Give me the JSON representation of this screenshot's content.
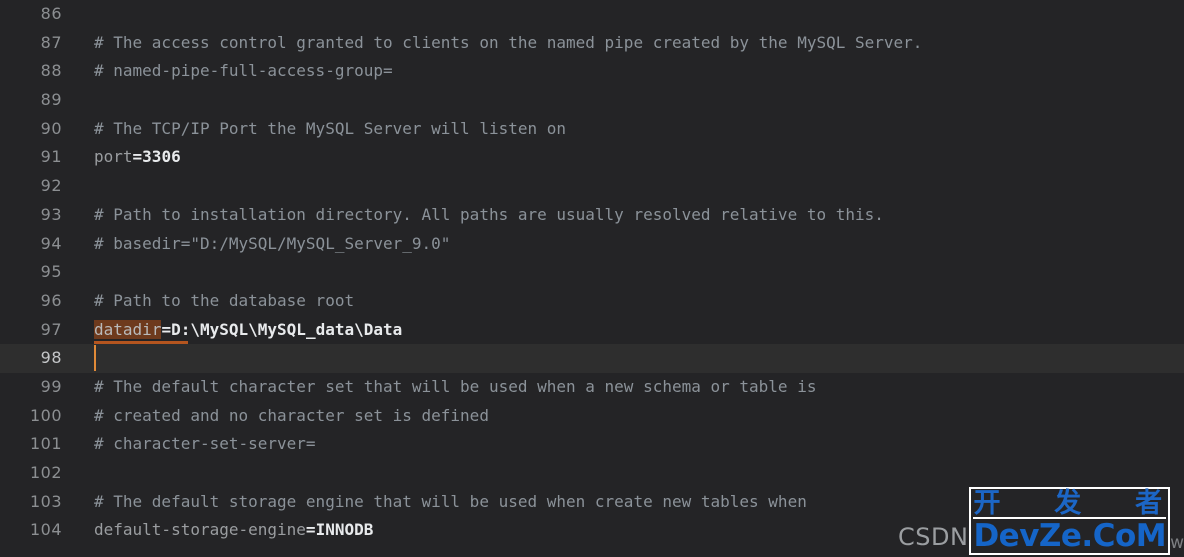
{
  "editor": {
    "theme": "dark",
    "file_type": "ini",
    "background_color": "#242426",
    "current_line_color": "#2e2e2e",
    "caret_color": "#e08a38",
    "search_highlight_color": "#6e3a1d",
    "gutter_color": "#8c8f92",
    "comment_color": "#8b9299",
    "key_color": "#9a9da0",
    "value_color": "#e8eaec",
    "first_visible_line": 86,
    "last_visible_line": 104,
    "caret_line": 98,
    "highlighted_token": "datadir",
    "lines": [
      {
        "number": "86",
        "current": false,
        "tokens": []
      },
      {
        "number": "87",
        "current": false,
        "tokens": [
          {
            "kind": "cmt",
            "text": "# The access control granted to clients on the named pipe created by the MySQL Server."
          }
        ]
      },
      {
        "number": "88",
        "current": false,
        "tokens": [
          {
            "kind": "cmt",
            "text": "# named-pipe-full-access-group="
          }
        ]
      },
      {
        "number": "89",
        "current": false,
        "tokens": []
      },
      {
        "number": "90",
        "current": false,
        "tokens": [
          {
            "kind": "cmt",
            "text": "# The TCP/IP Port the MySQL Server will listen on"
          }
        ]
      },
      {
        "number": "91",
        "current": false,
        "tokens": [
          {
            "kind": "key",
            "text": "port"
          },
          {
            "kind": "eq",
            "text": "="
          },
          {
            "kind": "val",
            "text": "3306"
          }
        ]
      },
      {
        "number": "92",
        "current": false,
        "tokens": []
      },
      {
        "number": "93",
        "current": false,
        "tokens": [
          {
            "kind": "cmt",
            "text": "# Path to installation directory. All paths are usually resolved relative to this."
          }
        ]
      },
      {
        "number": "94",
        "current": false,
        "tokens": [
          {
            "kind": "cmt",
            "text": "# basedir=\"D:/MySQL/MySQL_Server_9.0\""
          }
        ]
      },
      {
        "number": "95",
        "current": false,
        "tokens": []
      },
      {
        "number": "96",
        "current": false,
        "tokens": [
          {
            "kind": "cmt",
            "text": "# Path to the database root"
          }
        ]
      },
      {
        "number": "97",
        "current": false,
        "tokens": [
          {
            "kind": "hl",
            "text": "datadir"
          },
          {
            "kind": "eq",
            "text": "="
          },
          {
            "kind": "val",
            "text": "D:\\MySQL\\MySQL_data\\Data"
          }
        ]
      },
      {
        "number": "98",
        "current": true,
        "tokens": []
      },
      {
        "number": "99",
        "current": false,
        "tokens": [
          {
            "kind": "cmt",
            "text": "# The default character set that will be used when a new schema or table is"
          }
        ]
      },
      {
        "number": "100",
        "current": false,
        "tokens": [
          {
            "kind": "cmt",
            "text": "# created and no character set is defined"
          }
        ]
      },
      {
        "number": "101",
        "current": false,
        "tokens": [
          {
            "kind": "cmt",
            "text": "# character-set-server="
          }
        ]
      },
      {
        "number": "102",
        "current": false,
        "tokens": []
      },
      {
        "number": "103",
        "current": false,
        "tokens": [
          {
            "kind": "cmt",
            "text": "# The default storage engine that will be used when create new tables when"
          }
        ]
      },
      {
        "number": "104",
        "current": false,
        "tokens": [
          {
            "kind": "key",
            "text": "default-storage-engine"
          },
          {
            "kind": "eq",
            "text": "="
          },
          {
            "kind": "val",
            "text": "INNODB"
          }
        ]
      }
    ]
  },
  "watermark": {
    "csdn_label": "CSDN",
    "logo_cn": [
      "开",
      "发",
      "者"
    ],
    "logo_en": "DevZe.CoM",
    "tail": "w",
    "logo_color": "#1565c8",
    "csdn_color": "#9b9ea1"
  }
}
